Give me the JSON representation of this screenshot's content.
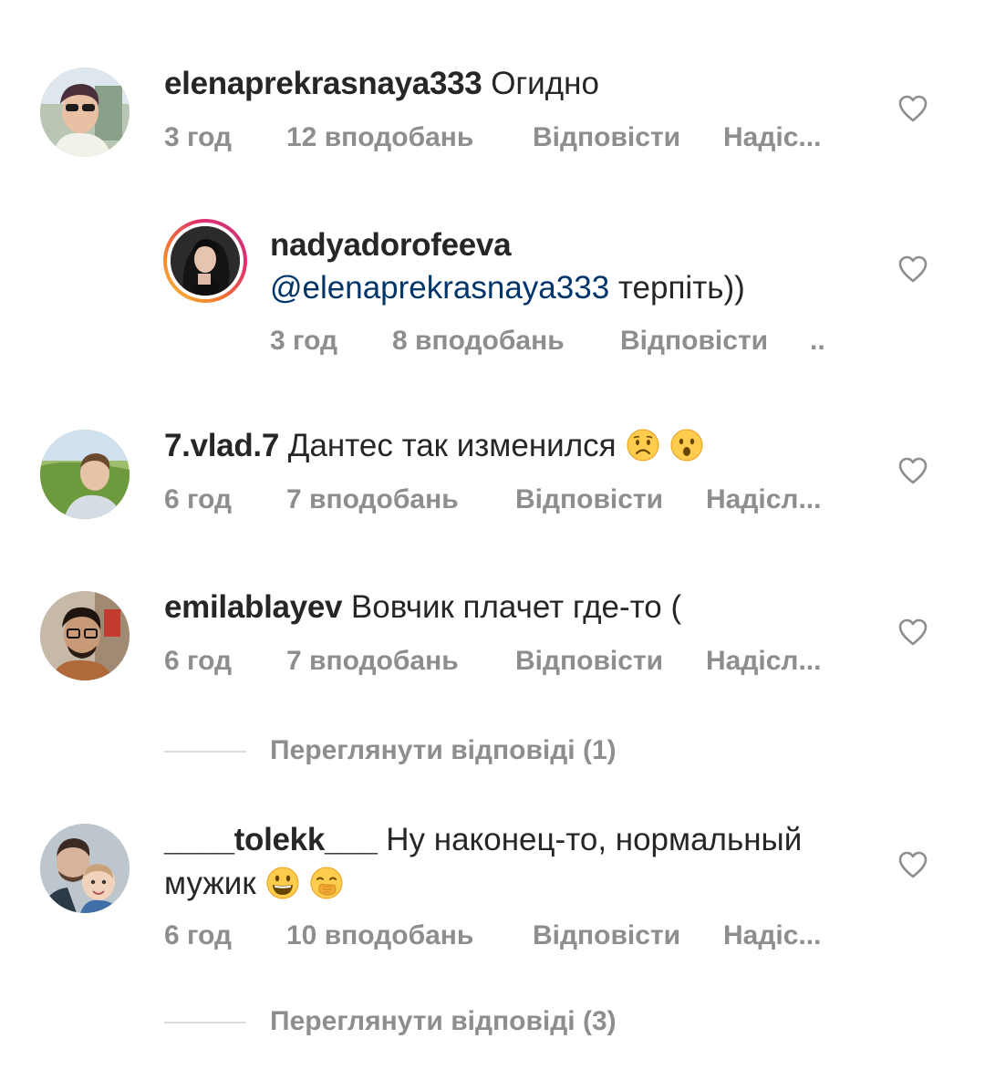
{
  "comments": [
    {
      "username": "elenaprekrasnaya333",
      "text": "Огидно",
      "time": "3 год",
      "likes": "12 вподобань",
      "reply": "Відповісти",
      "send": "Надіс..."
    },
    {
      "username": "nadyadorofeeva",
      "mention": "@elenaprekrasnaya333",
      "text": "терпіть))",
      "time": "3 год",
      "likes": "8 вподобань",
      "reply": "Відповісти",
      "send": ".."
    },
    {
      "username": "7.vlad.7",
      "text": "Дантес так изменился",
      "emojis": [
        "worried-face-emoji",
        "hushed-face-emoji"
      ],
      "time": "6 год",
      "likes": "7 вподобань",
      "reply": "Відповісти",
      "send": "Надісл..."
    },
    {
      "username": "emilablayev",
      "text": "Вовчик плачет где-то (",
      "time": "6 год",
      "likes": "7 вподобань",
      "reply": "Відповісти",
      "send": "Надісл..."
    },
    {
      "username": "____tolekk___",
      "text_line1": "Ну наконец-то, нормальный",
      "text_line2": "мужик",
      "emojis": [
        "grinning-face-emoji",
        "hand-over-mouth-emoji"
      ],
      "time": "6 год",
      "likes": "10 вподобань",
      "reply": "Відповісти",
      "send": "Надіс..."
    }
  ],
  "view_replies": [
    {
      "label": "Переглянути відповіді (1)"
    },
    {
      "label": "Переглянути відповіді (3)"
    }
  ],
  "icons": {
    "like": "heart-outline-icon"
  },
  "colors": {
    "text": "#262626",
    "meta": "#8e8e8e",
    "mention": "#003569",
    "divider": "#dbdbdb",
    "story_ring": [
      "#f9c33c",
      "#f27a2e",
      "#e1306c",
      "#c13584"
    ]
  }
}
